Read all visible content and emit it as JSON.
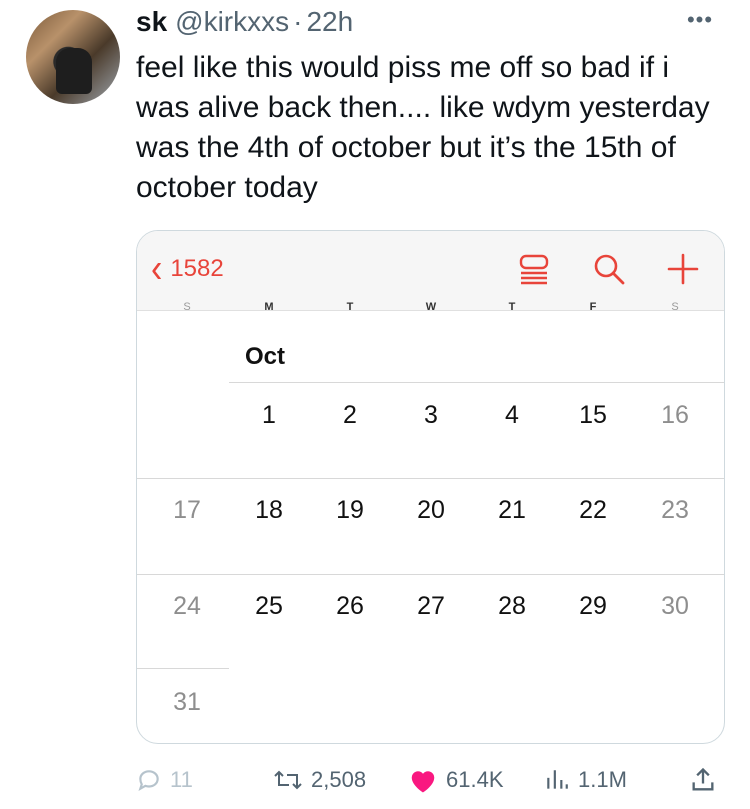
{
  "tweet": {
    "author_name": "sk",
    "handle": "@kirkxxs",
    "separator": "·",
    "time": "22h",
    "more_icon": "more-horizontal-icon",
    "text": "feel like this would piss me off so bad if i was alive back then.... like wdym yesterday was the 4th of october but it’s the 15th of october today"
  },
  "calendar": {
    "back_label": "1582",
    "accent_color": "#e8443a",
    "toolbar_icons": [
      "list-icon",
      "search-icon",
      "plus-icon"
    ],
    "weekdays": [
      "S",
      "M",
      "T",
      "W",
      "T",
      "F",
      "S"
    ],
    "month_label": "Oct",
    "weeks": [
      [
        "",
        "1",
        "2",
        "3",
        "4",
        "15",
        "16"
      ],
      [
        "17",
        "18",
        "19",
        "20",
        "21",
        "22",
        "23"
      ],
      [
        "24",
        "25",
        "26",
        "27",
        "28",
        "29",
        "30"
      ],
      [
        "31",
        "",
        "",
        "",
        "",
        "",
        ""
      ]
    ]
  },
  "actions": {
    "replies": "11",
    "retweets": "2,508",
    "likes": "61.4K",
    "views": "1.1M",
    "like_color": "#f91880"
  }
}
